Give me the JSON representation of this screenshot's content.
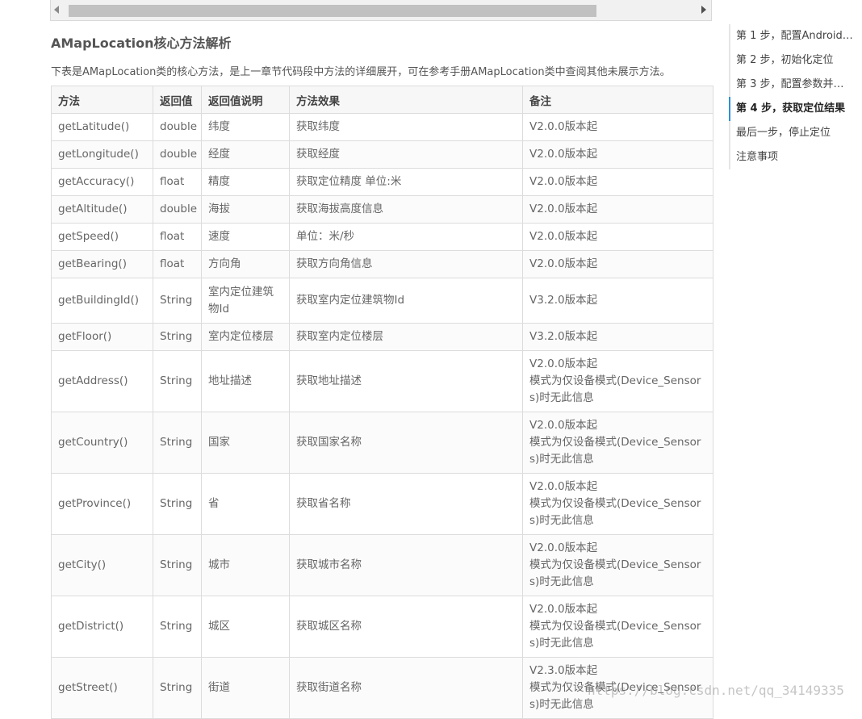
{
  "section_title": "AMapLocation核心方法解析",
  "intro": "下表是AMapLocation类的核心方法，是上一章节代码段中方法的详细展开，可在参考手册AMapLocation类中查阅其他未展示方法。",
  "table": {
    "headers": [
      "方法",
      "返回值",
      "返回值说明",
      "方法效果",
      "备注"
    ],
    "rows": [
      {
        "method": "getLatitude()",
        "ret": "double",
        "desc": "纬度",
        "effect": "获取纬度",
        "note": [
          "V2.0.0版本起"
        ]
      },
      {
        "method": "getLongitude()",
        "ret": "double",
        "desc": "经度",
        "effect": "获取经度",
        "note": [
          "V2.0.0版本起"
        ]
      },
      {
        "method": "getAccuracy()",
        "ret": "float",
        "desc": "精度",
        "effect": "获取定位精度 单位:米",
        "note": [
          "V2.0.0版本起"
        ]
      },
      {
        "method": "getAltitude()",
        "ret": "double",
        "desc": "海拔",
        "effect": "获取海拔高度信息",
        "note": [
          "V2.0.0版本起"
        ]
      },
      {
        "method": "getSpeed()",
        "ret": "float",
        "desc": "速度",
        "effect": "单位：米/秒",
        "note": [
          "V2.0.0版本起"
        ]
      },
      {
        "method": "getBearing()",
        "ret": "float",
        "desc": "方向角",
        "effect": "获取方向角信息",
        "note": [
          "V2.0.0版本起"
        ]
      },
      {
        "method": "getBuildingId()",
        "ret": "String",
        "desc": "室内定位建筑物Id",
        "effect": "获取室内定位建筑物Id",
        "note": [
          "V3.2.0版本起"
        ]
      },
      {
        "method": "getFloor()",
        "ret": "String",
        "desc": "室内定位楼层",
        "effect": "获取室内定位楼层",
        "note": [
          "V3.2.0版本起"
        ]
      },
      {
        "method": "getAddress()",
        "ret": "String",
        "desc": "地址描述",
        "effect": "获取地址描述",
        "note": [
          "V2.0.0版本起",
          "模式为仅设备模式(Device_Sensor",
          "s)时无此信息"
        ]
      },
      {
        "method": "getCountry()",
        "ret": "String",
        "desc": "国家",
        "effect": "获取国家名称",
        "note": [
          "V2.0.0版本起",
          "模式为仅设备模式(Device_Sensor",
          "s)时无此信息"
        ]
      },
      {
        "method": "getProvince()",
        "ret": "String",
        "desc": "省",
        "effect": "获取省名称",
        "note": [
          "V2.0.0版本起",
          "模式为仅设备模式(Device_Sensor",
          "s)时无此信息"
        ]
      },
      {
        "method": "getCity()",
        "ret": "String",
        "desc": "城市",
        "effect": "获取城市名称",
        "note": [
          "V2.0.0版本起",
          "模式为仅设备模式(Device_Sensor",
          "s)时无此信息"
        ]
      },
      {
        "method": "getDistrict()",
        "ret": "String",
        "desc": "城区",
        "effect": "获取城区名称",
        "note": [
          "V2.0.0版本起",
          "模式为仅设备模式(Device_Sensor",
          "s)时无此信息"
        ]
      },
      {
        "method": "getStreet()",
        "ret": "String",
        "desc": "街道",
        "effect": "获取街道名称",
        "note": [
          "V2.3.0版本起",
          "模式为仅设备模式(Device_Sensor",
          "s)时无此信息"
        ]
      }
    ]
  },
  "toc": {
    "items": [
      {
        "label": "第 1 步，配置Android…",
        "active": false
      },
      {
        "label": "第 2 步，初始化定位",
        "active": false
      },
      {
        "label": "第 3 步，配置参数并…",
        "active": false
      },
      {
        "label": "第 4 步，获取定位结果",
        "active": true
      },
      {
        "label": "最后一步，停止定位",
        "active": false
      },
      {
        "label": "注意事项",
        "active": false
      }
    ]
  },
  "watermark": "https://blog.csdn.net/qq_34149335"
}
